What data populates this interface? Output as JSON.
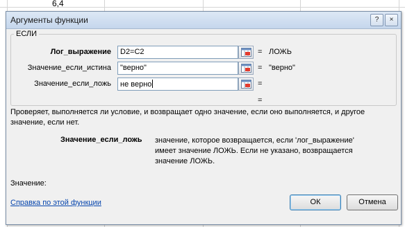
{
  "sheet": {
    "cell_value": "6,4"
  },
  "dialog": {
    "title": "Аргументы функции",
    "help_button": "?",
    "close_button": "×",
    "function_name": "ЕСЛИ",
    "args": [
      {
        "label": "Лог_выражение",
        "bold": true,
        "value": "D2=C2",
        "result": "ЛОЖЬ"
      },
      {
        "label": "Значение_если_истина",
        "bold": false,
        "value": "\"верно\"",
        "result": "\"верно\""
      },
      {
        "label": "Значение_если_ложь",
        "bold": false,
        "value": "не верно",
        "result": ""
      }
    ],
    "formula_result": "",
    "description": "Проверяет, выполняется ли условие, и возвращает одно значение, если оно выполняется, и другое значение, если нет.",
    "current_arg_name": "Значение_если_ложь",
    "current_arg_desc": "значение, которое возвращается, если 'лог_выражение' имеет значение ЛОЖЬ. Если не указано, возвращается значение ЛОЖЬ.",
    "value_label": "Значение:",
    "help_link": "Справка по этой функции",
    "ok_label": "ОК",
    "cancel_label": "Отмена"
  }
}
